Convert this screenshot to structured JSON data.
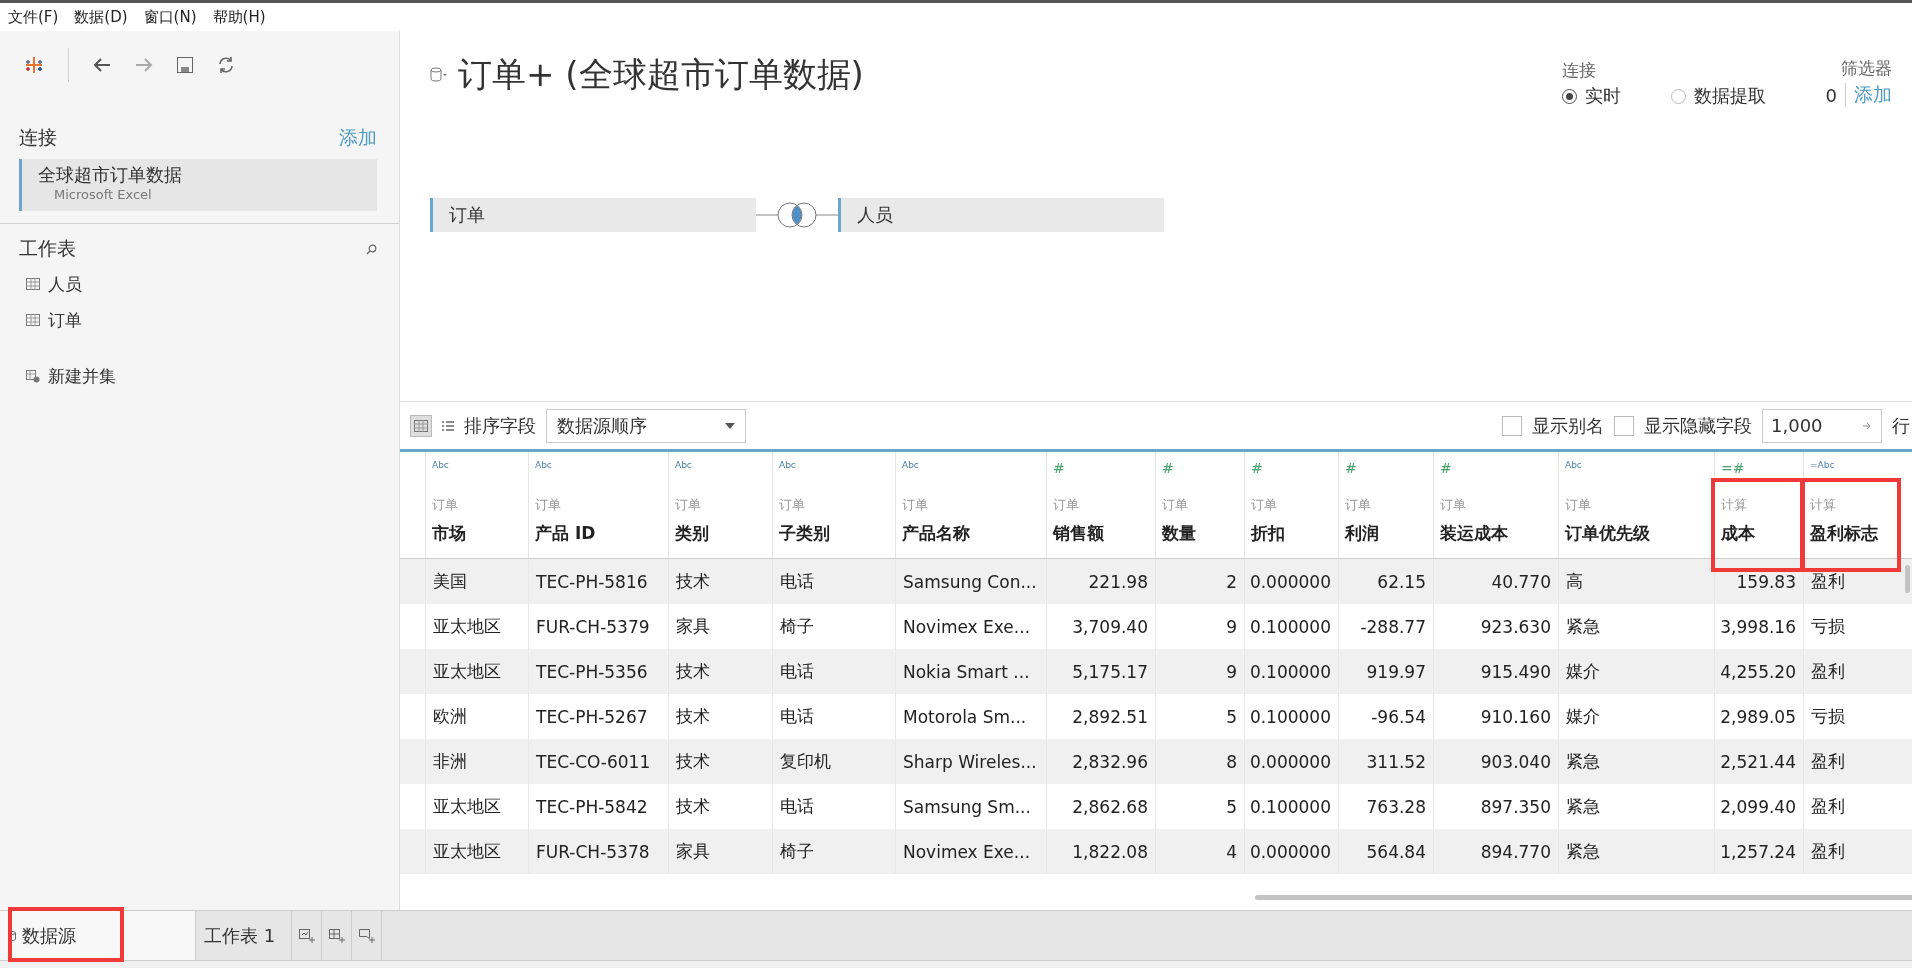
{
  "menu": [
    {
      "label": "文件(F)"
    },
    {
      "label": "数据(D)"
    },
    {
      "label": "窗口(N)"
    },
    {
      "label": "帮助(H)"
    }
  ],
  "sidebar": {
    "connections_label": "连接",
    "add_link": "添加",
    "connection": {
      "name": "全球超市订单数据",
      "type": "Microsoft Excel",
      "selected": true
    },
    "sheets_label": "工作表",
    "sheets": [
      {
        "name": "人员"
      },
      {
        "name": "订单"
      }
    ],
    "new_union": "新建并集"
  },
  "datasource": {
    "title": "订单+ (全球超市订单数据)",
    "connection_label": "连接",
    "connection_modes": [
      {
        "label": "实时",
        "selected": true
      },
      {
        "label": "数据提取",
        "selected": false
      }
    ],
    "filters_label": "筛选器",
    "filters_count": "0",
    "filters_add": "添加",
    "join": {
      "left": "订单",
      "right": "人员",
      "kind": "inner"
    }
  },
  "grid_toolbar": {
    "sort_label": "排序字段",
    "sort_value": "数据源顺序",
    "options": [
      {
        "label": "显示别名",
        "checked": false
      },
      {
        "label": "显示隐藏字段",
        "checked": false
      }
    ],
    "row_count": "1,000",
    "rows_label": "行"
  },
  "table": {
    "columns": [
      {
        "type_icon": "Abc",
        "kind": "text",
        "source": "订单",
        "name": "市场",
        "highlighted": false
      },
      {
        "type_icon": "Abc",
        "kind": "text",
        "source": "订单",
        "name": "产品 ID",
        "highlighted": false
      },
      {
        "type_icon": "Abc",
        "kind": "text",
        "source": "订单",
        "name": "类别",
        "highlighted": false
      },
      {
        "type_icon": "Abc",
        "kind": "text",
        "source": "订单",
        "name": "子类别",
        "highlighted": false
      },
      {
        "type_icon": "Abc",
        "kind": "text",
        "source": "订单",
        "name": "产品名称",
        "highlighted": false
      },
      {
        "type_icon": "#",
        "kind": "number",
        "source": "订单",
        "name": "销售额",
        "highlighted": false
      },
      {
        "type_icon": "#",
        "kind": "number",
        "source": "订单",
        "name": "数量",
        "highlighted": false
      },
      {
        "type_icon": "#",
        "kind": "number",
        "source": "订单",
        "name": "折扣",
        "highlighted": false
      },
      {
        "type_icon": "#",
        "kind": "number",
        "source": "订单",
        "name": "利润",
        "highlighted": false
      },
      {
        "type_icon": "#",
        "kind": "number",
        "source": "订单",
        "name": "装运成本",
        "highlighted": false
      },
      {
        "type_icon": "Abc",
        "kind": "text",
        "source": "订单",
        "name": "订单优先级",
        "highlighted": false
      },
      {
        "type_icon": "=#",
        "kind": "number",
        "source": "计算",
        "name": "成本",
        "highlighted": true
      },
      {
        "type_icon": "=Abc",
        "kind": "text",
        "source": "计算",
        "name": "盈利标志",
        "highlighted": true
      }
    ],
    "rows": [
      [
        "美国",
        "TEC-PH-5816",
        "技术",
        "电话",
        "Samsung Con...",
        "221.98",
        "2",
        "0.000000",
        "62.15",
        "40.770",
        "高",
        "159.83",
        "盈利"
      ],
      [
        "亚太地区",
        "FUR-CH-5379",
        "家具",
        "椅子",
        "Novimex Exe...",
        "3,709.40",
        "9",
        "0.100000",
        "-288.77",
        "923.630",
        "紧急",
        "3,998.16",
        "亏损"
      ],
      [
        "亚太地区",
        "TEC-PH-5356",
        "技术",
        "电话",
        "Nokia Smart ...",
        "5,175.17",
        "9",
        "0.100000",
        "919.97",
        "915.490",
        "媒介",
        "4,255.20",
        "盈利"
      ],
      [
        "欧洲",
        "TEC-PH-5267",
        "技术",
        "电话",
        "Motorola Sm...",
        "2,892.51",
        "5",
        "0.100000",
        "-96.54",
        "910.160",
        "媒介",
        "2,989.05",
        "亏损"
      ],
      [
        "非洲",
        "TEC-CO-6011",
        "技术",
        "复印机",
        "Sharp Wireles...",
        "2,832.96",
        "8",
        "0.000000",
        "311.52",
        "903.040",
        "紧急",
        "2,521.44",
        "盈利"
      ],
      [
        "亚太地区",
        "TEC-PH-5842",
        "技术",
        "电话",
        "Samsung Sm...",
        "2,862.68",
        "5",
        "0.100000",
        "763.28",
        "897.350",
        "紧急",
        "2,099.40",
        "盈利"
      ],
      [
        "亚太地区",
        "FUR-CH-5378",
        "家具",
        "椅子",
        "Novimex Exe...",
        "1,822.08",
        "4",
        "0.000000",
        "564.84",
        "894.770",
        "紧急",
        "1,257.24",
        "盈利"
      ]
    ]
  },
  "tabs": [
    {
      "label": "数据源",
      "selected": true,
      "highlighted": true
    },
    {
      "label": "工作表 1",
      "selected": false,
      "highlighted": false
    }
  ]
}
